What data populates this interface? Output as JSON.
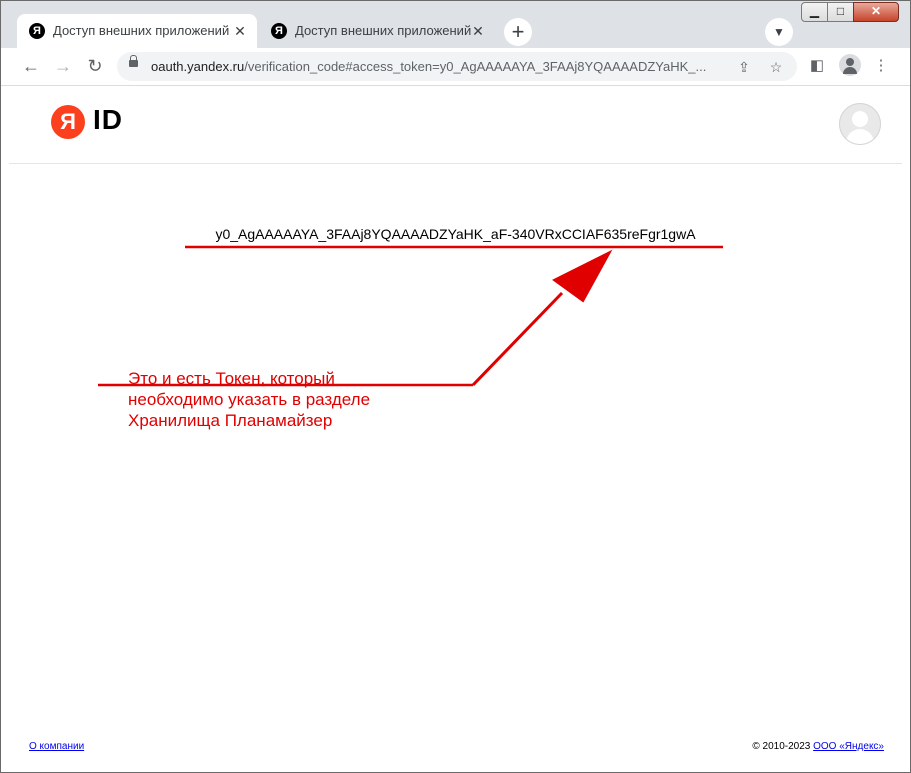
{
  "browser": {
    "tabs": [
      {
        "title": "Доступ внешних приложений",
        "active": true
      },
      {
        "title": "Доступ внешних приложений",
        "active": false
      }
    ],
    "url_host": "oauth.yandex.ru",
    "url_rest": "/verification_code#access_token=y0_AgAAAAAYA_3FAAj8YQAAAADZYaHK_..."
  },
  "header": {
    "logo_letter": "Я",
    "logo_text": "ID"
  },
  "main": {
    "token": "y0_AgAAAAAYA_3FAAj8YQAAAADZYaHK_aF-340VRxCCIAF635reFgr1gwA"
  },
  "annotation": {
    "lines": [
      "Это и есть Токен, который",
      "необходимо указать в разделе",
      "Хранилища Планамайзер"
    ],
    "color": "#e00000"
  },
  "footer": {
    "about_link": "О компании",
    "copyright": "© 2010-2023 ",
    "company_link": "ООО «Яндекс»"
  },
  "colors": {
    "brand": "#fc3f1d"
  }
}
